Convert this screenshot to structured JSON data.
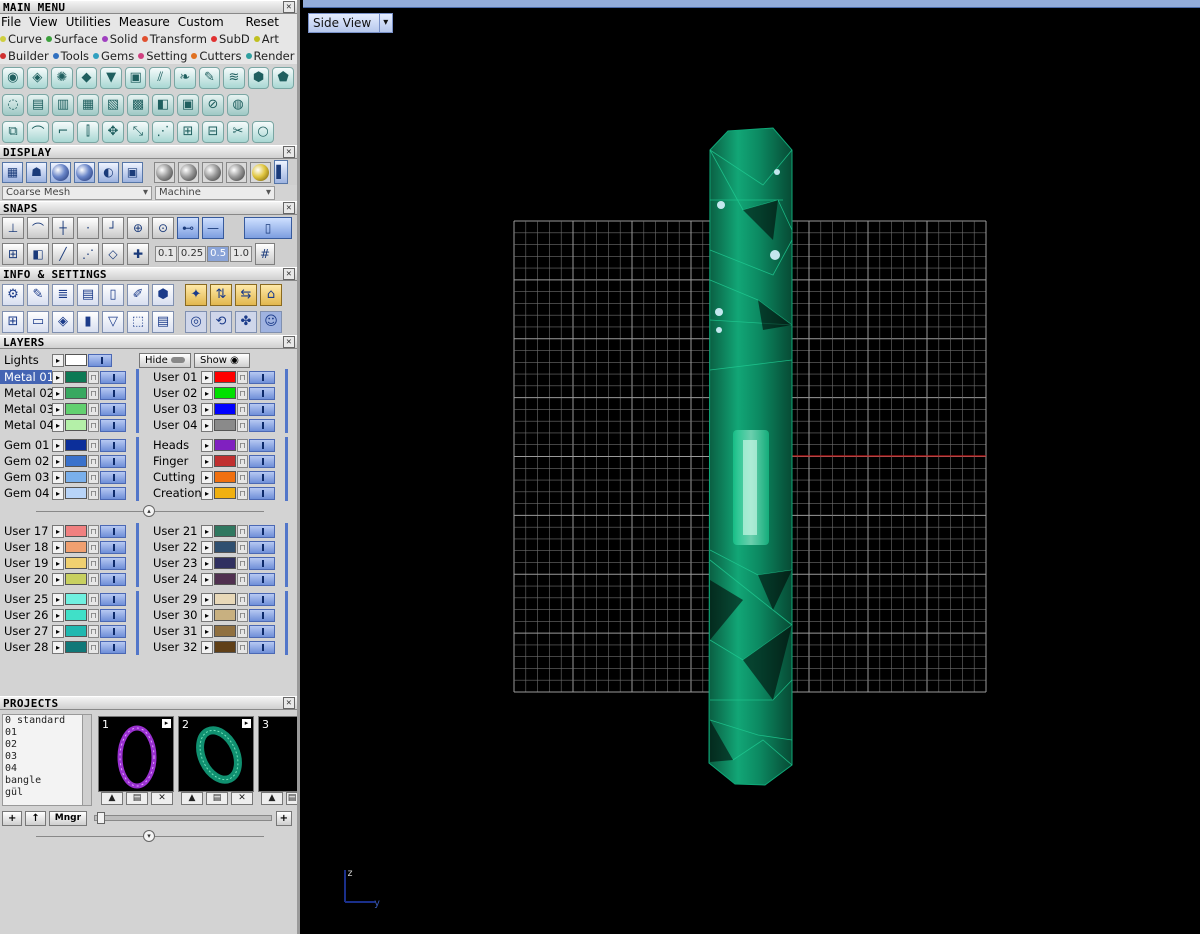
{
  "main_menu": {
    "title": "MAIN MENU",
    "menubar": [
      "File",
      "View",
      "Utilities",
      "Measure",
      "Custom"
    ],
    "reset_label": "Reset",
    "categories_row1": [
      {
        "label": "Curve",
        "color": "#cfcf40"
      },
      {
        "label": "Surface",
        "color": "#3ca03c"
      },
      {
        "label": "Solid",
        "color": "#a040c0"
      },
      {
        "label": "Transform",
        "color": "#e05030"
      },
      {
        "label": "SubD",
        "color": "#e03030"
      },
      {
        "label": "Art",
        "color": "#c0c020"
      }
    ],
    "categories_row2": [
      {
        "label": "Builder",
        "color": "#d03030"
      },
      {
        "label": "Tools",
        "color": "#3070c0"
      },
      {
        "label": "Gems",
        "color": "#30a0c0"
      },
      {
        "label": "Setting",
        "color": "#d04080"
      },
      {
        "label": "Cutters",
        "color": "#e07020"
      },
      {
        "label": "Render",
        "color": "#30a0a0"
      }
    ]
  },
  "display": {
    "title": "DISPLAY",
    "mesh_select": "Coarse Mesh",
    "render_select": "Machine"
  },
  "snaps": {
    "title": "SNAPS",
    "values": [
      "0.1",
      "0.25",
      "0.5",
      "1.0"
    ]
  },
  "info_settings": {
    "title": "INFO & SETTINGS"
  },
  "layers": {
    "title": "LAYERS",
    "lights_label": "Lights",
    "hide_label": "Hide",
    "show_label": "Show",
    "left_groups": [
      [
        {
          "name": "Metal 01",
          "color": "#0d7a55",
          "selected": true
        },
        {
          "name": "Metal 02",
          "color": "#38a860"
        },
        {
          "name": "Metal 03",
          "color": "#62d070"
        },
        {
          "name": "Metal 04",
          "color": "#b4f0a8"
        }
      ],
      [
        {
          "name": "Gem 01",
          "color": "#0c2f9a"
        },
        {
          "name": "Gem 02",
          "color": "#3a72cc"
        },
        {
          "name": "Gem 03",
          "color": "#7ab0ec"
        },
        {
          "name": "Gem 04",
          "color": "#b8d4f8"
        }
      ],
      [
        {
          "name": "User 17",
          "color": "#f08080"
        },
        {
          "name": "User 18",
          "color": "#f0a070"
        },
        {
          "name": "User 19",
          "color": "#f0d070"
        },
        {
          "name": "User 20",
          "color": "#c8d060"
        }
      ],
      [
        {
          "name": "User 25",
          "color": "#70f0e0"
        },
        {
          "name": "User 26",
          "color": "#40e0c8"
        },
        {
          "name": "User 27",
          "color": "#20b8b0"
        },
        {
          "name": "User 28",
          "color": "#107878"
        }
      ]
    ],
    "right_groups": [
      [
        {
          "name": "User 01",
          "color": "#ff0000"
        },
        {
          "name": "User 02",
          "color": "#00e000"
        },
        {
          "name": "User 03",
          "color": "#0000ff"
        },
        {
          "name": "User 04",
          "color": "#8a8a8a"
        }
      ],
      [
        {
          "name": "Heads",
          "color": "#8020c0"
        },
        {
          "name": "Finger",
          "color": "#c03030"
        },
        {
          "name": "Cutting",
          "color": "#f07010"
        },
        {
          "name": "Creation",
          "color": "#f0b010"
        }
      ],
      [
        {
          "name": "User 21",
          "color": "#307860"
        },
        {
          "name": "User 22",
          "color": "#305070"
        },
        {
          "name": "User 23",
          "color": "#303060"
        },
        {
          "name": "User 24",
          "color": "#503050"
        }
      ],
      [
        {
          "name": "User 29",
          "color": "#e8d8b8"
        },
        {
          "name": "User 30",
          "color": "#c8b080"
        },
        {
          "name": "User 31",
          "color": "#907040"
        },
        {
          "name": "User 32",
          "color": "#604018"
        }
      ]
    ]
  },
  "projects": {
    "title": "PROJECTS",
    "list": [
      "0 standard",
      "01",
      "02",
      "03",
      "04",
      "bangle",
      "gül"
    ],
    "slots": [
      {
        "num": "1",
        "color": "#9a30d0"
      },
      {
        "num": "2",
        "color": "#109070"
      },
      {
        "num": "3",
        "color": ""
      }
    ],
    "manager_label": "Mngr"
  },
  "viewport": {
    "view_name": "Side View",
    "axis_z": "z",
    "axis_y": "y",
    "grid_color": "#6e6e6e",
    "model_color": "#0f9c6e"
  }
}
